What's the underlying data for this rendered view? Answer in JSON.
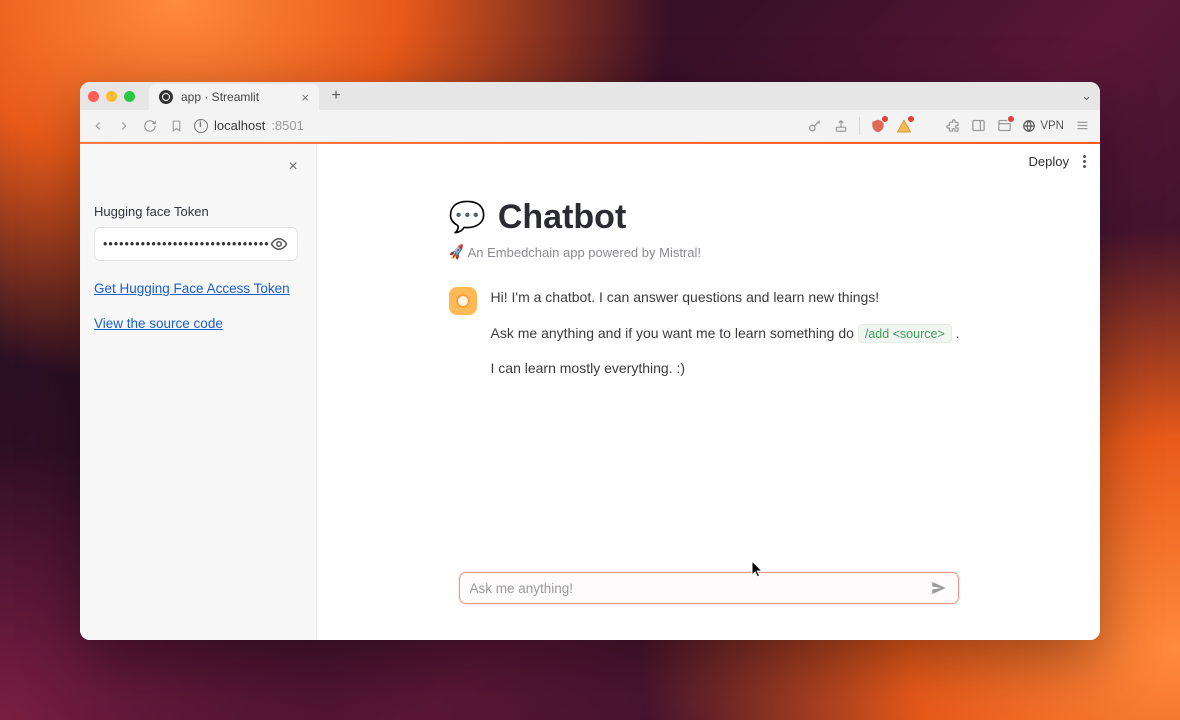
{
  "browser": {
    "tab": {
      "title": "app · Streamlit"
    },
    "url": {
      "host": "localhost",
      "port": ":8501"
    },
    "vpn_label": "VPN"
  },
  "sidebar": {
    "token_label": "Hugging face Token",
    "token_value": "••••••••••••••••••••••••••••••••",
    "link_get_token": "Get Hugging Face Access Token",
    "link_source": "View the source code"
  },
  "toolbar": {
    "deploy": "Deploy"
  },
  "page": {
    "title": "Chatbot",
    "subtitle_prefix": "🚀",
    "subtitle": "An Embedchain app powered by Mistral!"
  },
  "message": {
    "line1": "Hi! I'm a chatbot. I can answer questions and learn new things!",
    "line2_pre": "Ask me anything and if you want me to learn something do ",
    "line2_code": "/add <source>",
    "line2_post": " .",
    "line3": "I can learn mostly everything. :)"
  },
  "input": {
    "placeholder": "Ask me anything!"
  }
}
